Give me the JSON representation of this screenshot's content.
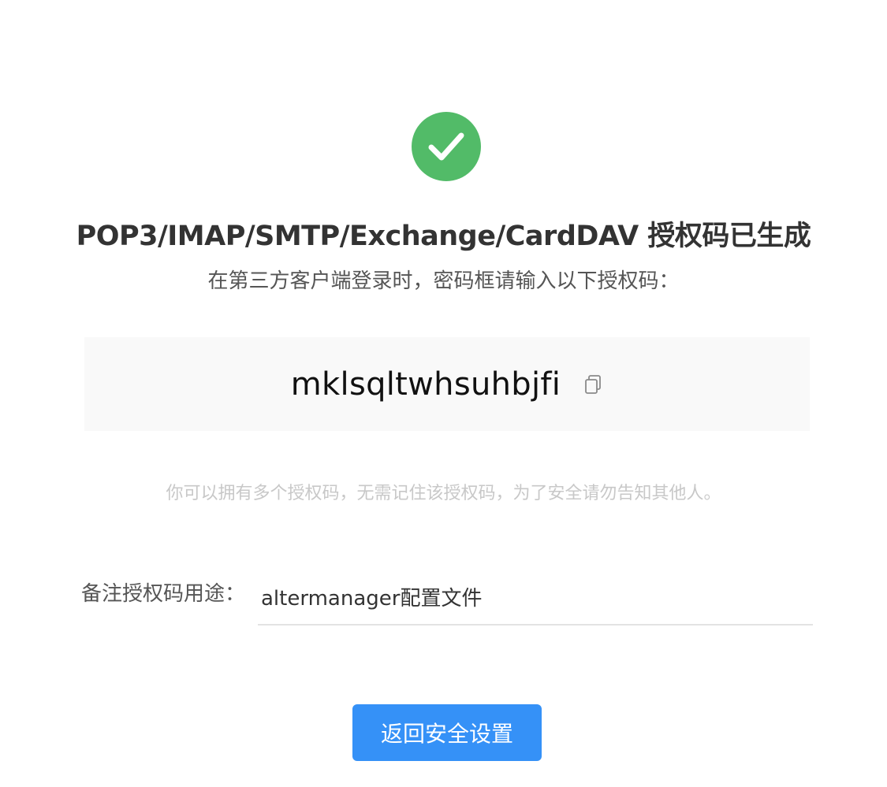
{
  "status": {
    "icon": "check-circle-icon",
    "color": "#52bb68"
  },
  "header": {
    "title": "POP3/IMAP/SMTP/Exchange/CardDAV 授权码已生成",
    "subtitle": "在第三方客户端登录时，密码框请输入以下授权码："
  },
  "auth_code": {
    "value": "mklsqltwhsuhbjfi",
    "copy_icon": "copy-icon"
  },
  "hint": "你可以拥有多个授权码，无需记住该授权码，为了安全请勿告知其他人。",
  "remark": {
    "label": "备注授权码用途：",
    "value": "altermanager配置文件"
  },
  "actions": {
    "back_label": "返回安全设置",
    "accent_color": "#3591f7"
  }
}
